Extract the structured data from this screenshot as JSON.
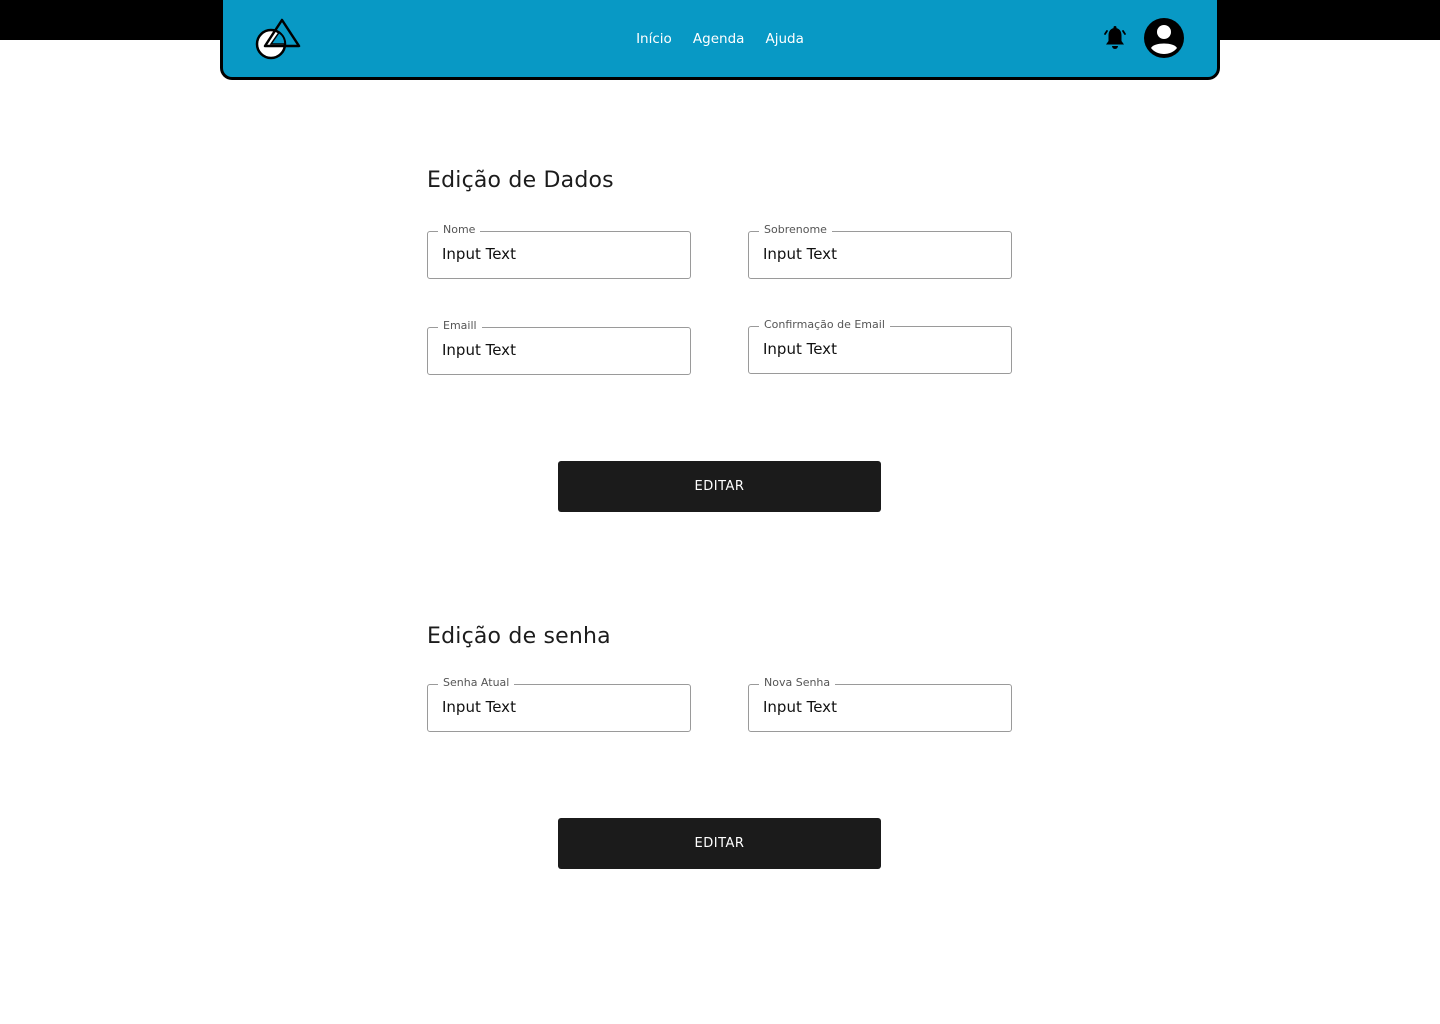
{
  "header": {
    "logo_icon": "shapes-logo-icon",
    "nav": [
      {
        "label": "Início"
      },
      {
        "label": "Agenda"
      },
      {
        "label": "Ajuda"
      }
    ],
    "bell_icon": "bell-icon",
    "avatar_icon": "user-avatar-icon",
    "colors": {
      "bar": "#0899c5",
      "border": "#000000",
      "text": "#ffffff"
    }
  },
  "data_section": {
    "title": "Edição de Dados",
    "fields": [
      {
        "label": "Nome",
        "value": "Input Text"
      },
      {
        "label": "Sobrenome",
        "value": "Input Text"
      },
      {
        "label": "Emaill",
        "value": "Input Text"
      },
      {
        "label": "Confirmação de Email",
        "value": "Input Text"
      }
    ],
    "button_label": "EDITAR"
  },
  "password_section": {
    "title": "Edição de senha",
    "fields": [
      {
        "label": "Senha Atual",
        "value": "Input Text"
      },
      {
        "label": "Nova Senha",
        "value": "Input Text"
      }
    ],
    "button_label": "EDITAR"
  },
  "colors": {
    "button": "#1b1b1b",
    "button_text": "#ffffff"
  }
}
